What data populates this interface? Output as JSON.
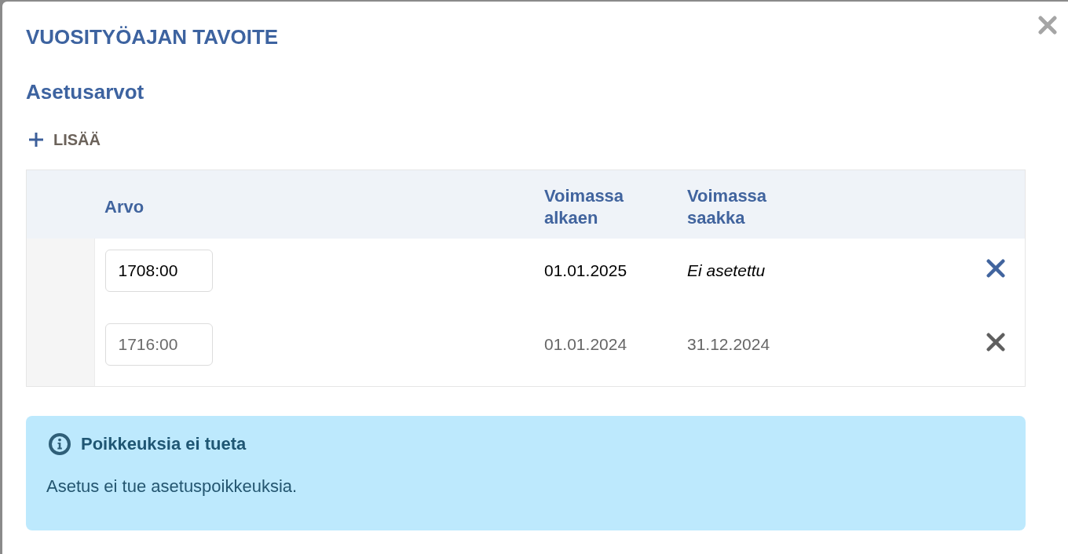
{
  "dialog": {
    "title": "VUOSITYÖAJAN TAVOITE"
  },
  "section": {
    "title": "Asetusarvot",
    "add_button": {
      "label": "LISÄÄ"
    }
  },
  "table": {
    "columns": [
      "Arvo",
      "Voimassa alkaen",
      "Voimassa saakka"
    ],
    "rows": [
      {
        "value": "1708:00",
        "valid_from": "01.01.2025",
        "valid_until": {
          "text": "Ei asetettu",
          "set": false
        },
        "disabled": false
      },
      {
        "value": "1716:00",
        "valid_from": "01.01.2024",
        "valid_until": {
          "text": "31.12.2024",
          "set": true
        },
        "disabled": true
      }
    ]
  },
  "notice": {
    "title": "Poikkeuksia ei tueta",
    "text": "Asetus ei tue asetuspoikkeuksia."
  }
}
